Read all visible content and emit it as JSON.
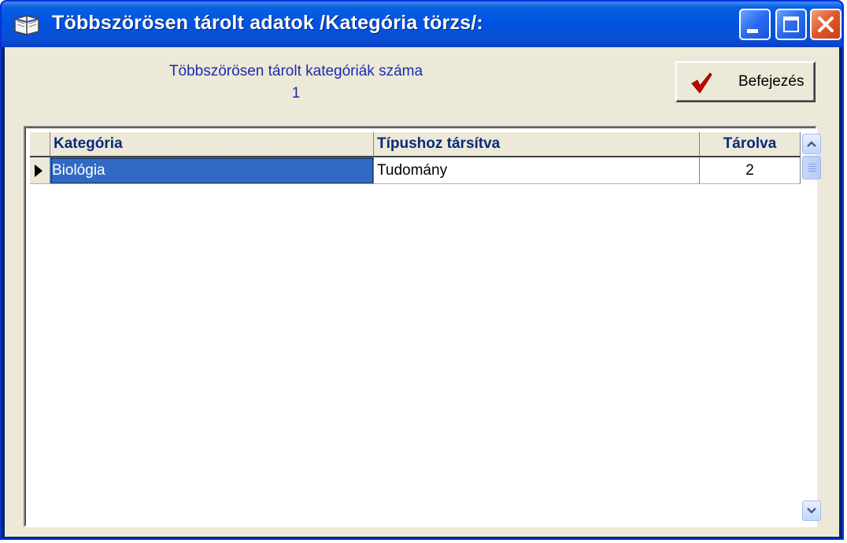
{
  "window": {
    "title": "Többszörösen tárolt adatok /Kategória törzs/:"
  },
  "info": {
    "label": "Többszörösen tárolt kategóriák száma",
    "count": "1",
    "color": "#1c2bb0"
  },
  "toolbar": {
    "finish_label": "Befejezés"
  },
  "grid": {
    "columns": [
      "Kategória",
      "Típushoz társítva",
      "Tárolva"
    ],
    "rows": [
      {
        "category": "Biológia",
        "type": "Tudomány",
        "stored": "2",
        "selected": true
      }
    ],
    "selection_color": "#316ac5"
  },
  "icons": {
    "app": "book-icon",
    "finish": "checkmark-icon",
    "minimize": "minimize-icon",
    "maximize": "maximize-icon",
    "close": "close-icon",
    "scroll_up": "chevron-up-icon",
    "scroll_down": "chevron-down-icon"
  }
}
